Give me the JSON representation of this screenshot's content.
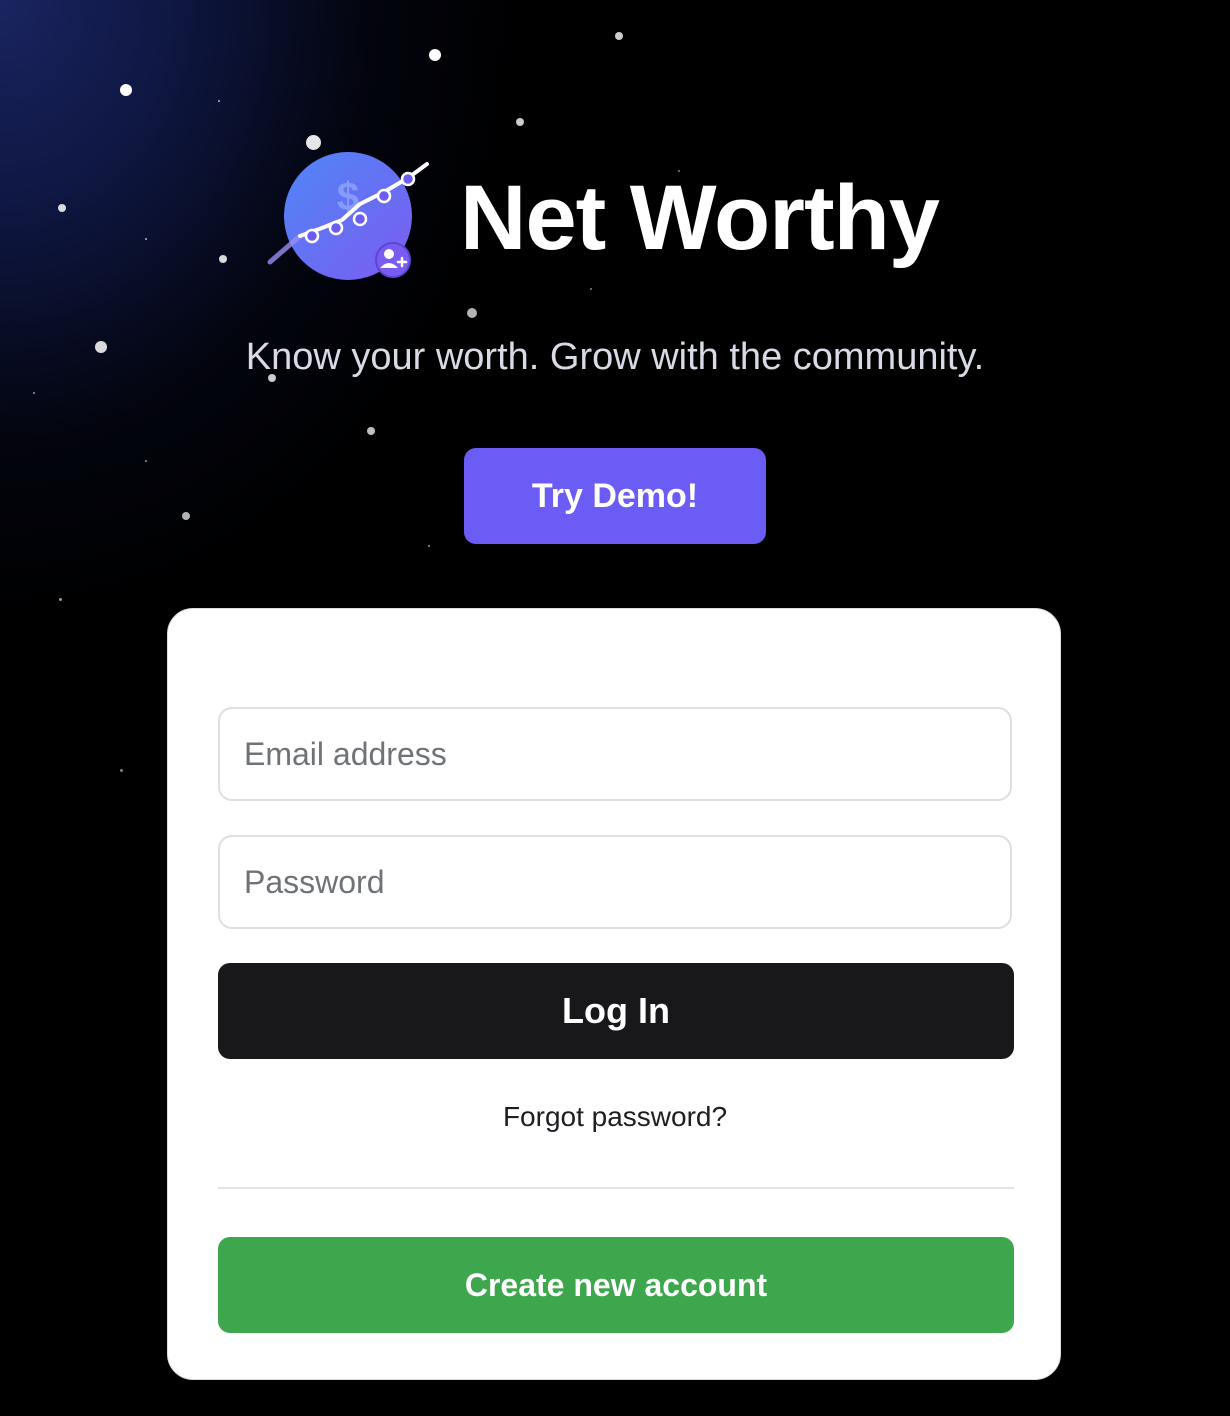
{
  "brand": {
    "name": "Net Worthy",
    "tagline": "Know your worth. Grow with the community.",
    "logo_icon": "planet-chart-dollar-icon",
    "logo_badge_icon": "add-user-icon"
  },
  "demo": {
    "label": "Try Demo!"
  },
  "login_form": {
    "email_placeholder": "Email address",
    "password_placeholder": "Password",
    "login_label": "Log In",
    "forgot_label": "Forgot password?",
    "create_label": "Create new account"
  },
  "colors": {
    "accent": "#6b5cf6",
    "login_button": "#18181a",
    "create_button": "#3ea64c",
    "background": "#000000"
  }
}
